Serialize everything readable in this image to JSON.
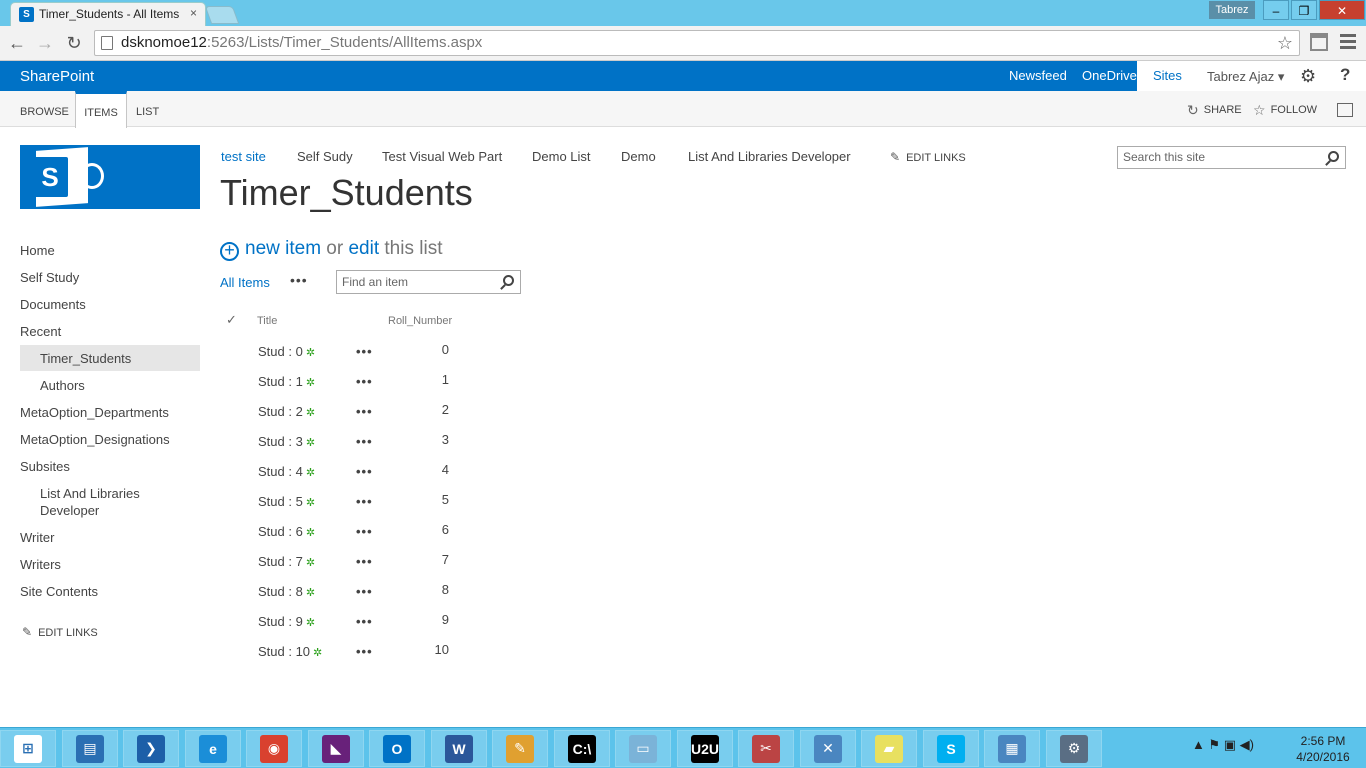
{
  "browser": {
    "tab_title": "Timer_Students - All Items",
    "tab_close": "×",
    "user_chip": "Tabrez",
    "window_buttons": [
      "–",
      "❐",
      "✕"
    ],
    "back": "←",
    "forward": "→",
    "reload": "↻",
    "url_host": "dsknomoe12",
    "url_rest": ":5263/Lists/Timer_Students/AllItems.aspx",
    "star": "☆"
  },
  "suite": {
    "brand": "SharePoint",
    "links": [
      "Newsfeed",
      "OneDrive",
      "Sites"
    ],
    "user": "Tabrez Ajaz ▾",
    "gear": "⚙",
    "help": "?"
  },
  "ribbon": {
    "tabs": [
      "BROWSE",
      "ITEMS",
      "LIST"
    ],
    "share": "SHARE",
    "follow": "FOLLOW",
    "share_icon": "↻",
    "follow_icon": "☆"
  },
  "topnav": {
    "items": [
      "test site",
      "Self Sudy",
      "Test Visual Web Part",
      "Demo List",
      "Demo",
      "List And Libraries Developer"
    ],
    "edit_links": "EDIT LINKS",
    "search_placeholder": "Search this site"
  },
  "page_title": "Timer_Students",
  "leftnav": {
    "items": [
      "Home",
      "Self Study",
      "Documents",
      "Recent",
      "Timer_Students",
      "Authors",
      "MetaOption_Departments",
      "MetaOption_Designations",
      "Subsites",
      "List And Libraries",
      "Developer",
      "Writer",
      "Writers",
      "Site Contents"
    ],
    "edit_links": "EDIT LINKS"
  },
  "list": {
    "new_item": "new item",
    "or": " or ",
    "edit": "edit",
    "this_list": " this list",
    "view_name": "All Items",
    "view_more": "•••",
    "find_placeholder": "Find an item",
    "check": "✓",
    "col_title": "Title",
    "col_roll": "Roll_Number",
    "rows": [
      {
        "title": "Stud : 0",
        "roll": "0"
      },
      {
        "title": "Stud : 1",
        "roll": "1"
      },
      {
        "title": "Stud : 2",
        "roll": "2"
      },
      {
        "title": "Stud : 3",
        "roll": "3"
      },
      {
        "title": "Stud : 4",
        "roll": "4"
      },
      {
        "title": "Stud : 5",
        "roll": "5"
      },
      {
        "title": "Stud : 6",
        "roll": "6"
      },
      {
        "title": "Stud : 7",
        "roll": "7"
      },
      {
        "title": "Stud : 8",
        "roll": "8"
      },
      {
        "title": "Stud : 9",
        "roll": "9"
      },
      {
        "title": "Stud : 10",
        "roll": "10"
      }
    ],
    "new_marker": "✲",
    "row_menu": "•••"
  },
  "taskbar": {
    "apps": [
      {
        "name": "start-button",
        "glyph": "⊞",
        "color": "#ffffff"
      },
      {
        "name": "server-manager",
        "glyph": "▤",
        "color": "#2a6fb3"
      },
      {
        "name": "powershell",
        "glyph": "❯",
        "color": "#1d5fa8"
      },
      {
        "name": "internet-explorer",
        "glyph": "e",
        "color": "#1b8ed8"
      },
      {
        "name": "chrome",
        "glyph": "◉",
        "color": "#d9412f"
      },
      {
        "name": "visual-studio",
        "glyph": "◣",
        "color": "#68217a"
      },
      {
        "name": "outlook",
        "glyph": "O",
        "color": "#0072c6"
      },
      {
        "name": "word",
        "glyph": "W",
        "color": "#2b579a"
      },
      {
        "name": "paint",
        "glyph": "✎",
        "color": "#e0a030"
      },
      {
        "name": "command-prompt",
        "glyph": "C:\\",
        "color": "#000000"
      },
      {
        "name": "notepad",
        "glyph": "▭",
        "color": "#7bb3d8"
      },
      {
        "name": "u2u",
        "glyph": "U2U",
        "color": "#000000"
      },
      {
        "name": "tool-1",
        "glyph": "✂",
        "color": "#b44"
      },
      {
        "name": "tool-2",
        "glyph": "✕",
        "color": "#4a86c0"
      },
      {
        "name": "sticky-notes",
        "glyph": "▰",
        "color": "#e8e060"
      },
      {
        "name": "skype",
        "glyph": "S",
        "color": "#00aff0"
      },
      {
        "name": "control-panel",
        "glyph": "▦",
        "color": "#4a86c0"
      },
      {
        "name": "settings",
        "glyph": "⚙",
        "color": "#5a6e84"
      }
    ],
    "tray": "▲  ⚑  ▣  ◀)",
    "time": "2:56 PM",
    "date": "4/20/2016"
  }
}
